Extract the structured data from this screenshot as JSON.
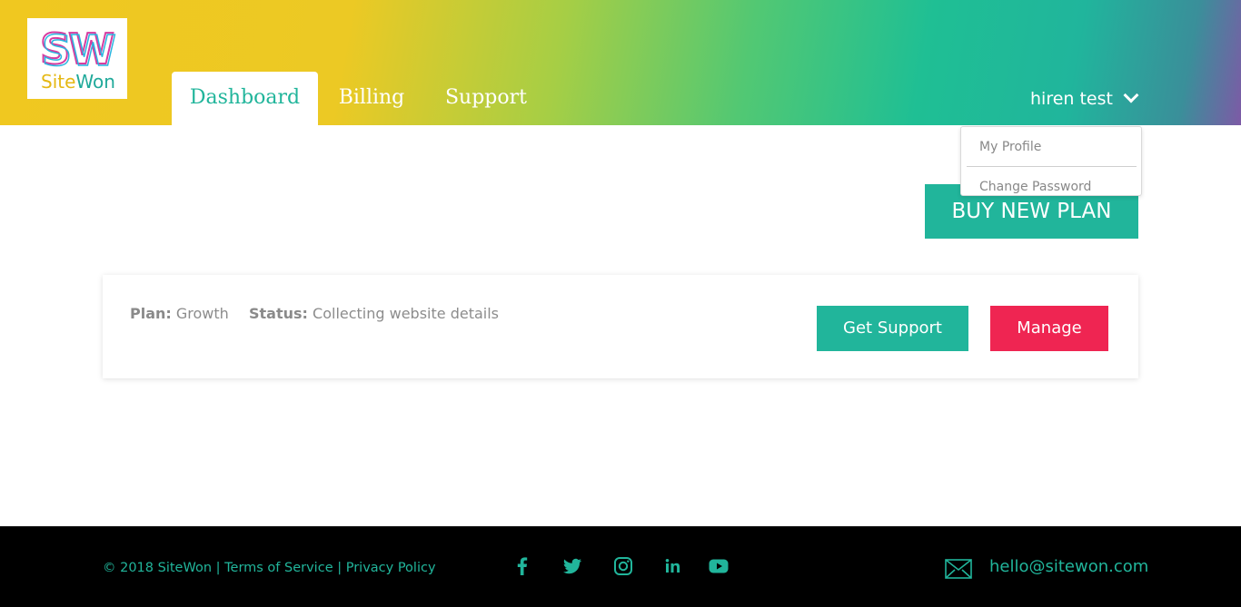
{
  "header": {
    "logo": {
      "mark": "SW",
      "name_part1": "Site",
      "name_part2": "Won"
    },
    "tabs": [
      {
        "label": "Dashboard",
        "active": true
      },
      {
        "label": "Billing",
        "active": false
      },
      {
        "label": "Support",
        "active": false
      }
    ],
    "user": {
      "name": "hiren test",
      "icon": "chevron-down-icon"
    }
  },
  "user_menu": {
    "items": [
      "My Profile",
      "Change Password"
    ]
  },
  "main": {
    "buy_button": "BUY NEW PLAN",
    "plan_card": {
      "plan_label": "Plan:",
      "plan_value": "Growth",
      "status_label": "Status:",
      "status_value": "Collecting website details",
      "support_button": "Get Support",
      "manage_button": "Manage"
    }
  },
  "footer": {
    "copyright": "© 2018 SiteWon",
    "separator": "|",
    "terms": "Terms of Service",
    "privacy": "Privacy Policy",
    "social_icons": [
      "facebook-icon",
      "twitter-icon",
      "instagram-icon",
      "linkedin-icon",
      "youtube-icon"
    ],
    "email": "hello@sitewon.com"
  },
  "colors": {
    "accent": "#21b59b",
    "danger": "#ef2552",
    "footer_bg": "#000000"
  }
}
